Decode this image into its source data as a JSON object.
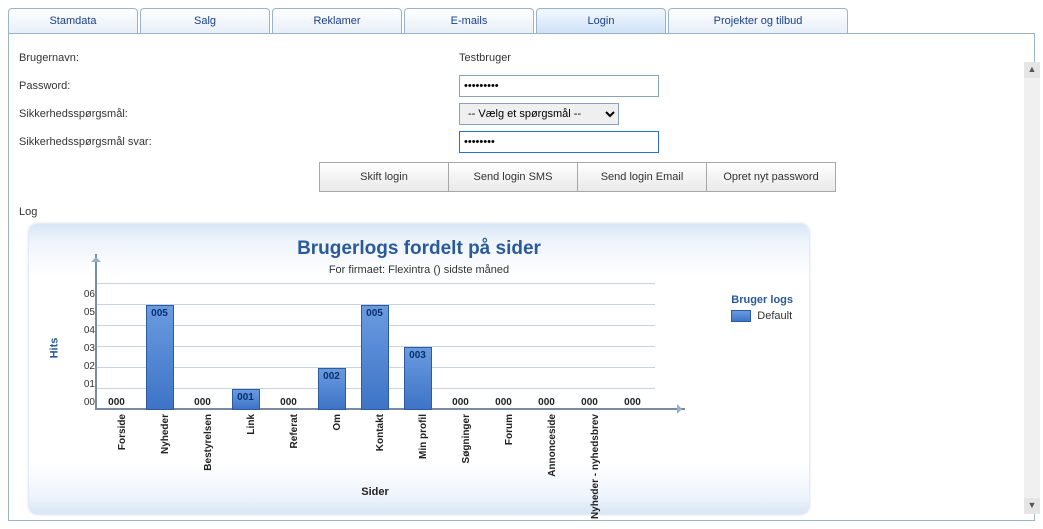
{
  "tabs": [
    {
      "label": "Stamdata"
    },
    {
      "label": "Salg"
    },
    {
      "label": "Reklamer"
    },
    {
      "label": "E-mails"
    },
    {
      "label": "Login",
      "active": true
    },
    {
      "label": "Projekter og tilbud",
      "wide": true
    }
  ],
  "form": {
    "username_label": "Brugernavn:",
    "username_value": "Testbruger",
    "password_label": "Password:",
    "password_value": "*********",
    "question_label": "Sikkerhedsspørgsmål:",
    "question_value": "-- Vælg et spørgsmål --",
    "answer_label": "Sikkerhedsspørgsmål svar:",
    "answer_value": "********"
  },
  "buttons": {
    "shift_login": "Skift login",
    "send_sms": "Send login SMS",
    "send_email": "Send login Email",
    "new_password": "Opret nyt password"
  },
  "log_label": "Log",
  "chart_data": {
    "type": "bar",
    "title": "Brugerlogs fordelt på sider",
    "subtitle": "For firmaet: Flexintra  () sidste måned",
    "xlabel": "Sider",
    "ylabel": "Hits",
    "ylim": [
      0,
      6
    ],
    "yticks": [
      "06",
      "05",
      "04",
      "03",
      "02",
      "01",
      "00"
    ],
    "legend_title": "Bruger logs",
    "legend_item": "Default",
    "categories": [
      "Forside",
      "Nyheder",
      "Bestyrelsen",
      "Link",
      "Referat",
      "Om",
      "Kontakt",
      "Min profil",
      "Søgninger",
      "Forum",
      "Annonceside",
      "Nyheder - nyhedsbrev",
      ""
    ],
    "values": [
      0,
      5,
      0,
      1,
      0,
      2,
      5,
      3,
      0,
      0,
      0,
      0,
      0
    ],
    "labels": [
      "000",
      "005",
      "000",
      "001",
      "000",
      "002",
      "005",
      "003",
      "000",
      "000",
      "000",
      "000",
      "000"
    ]
  }
}
